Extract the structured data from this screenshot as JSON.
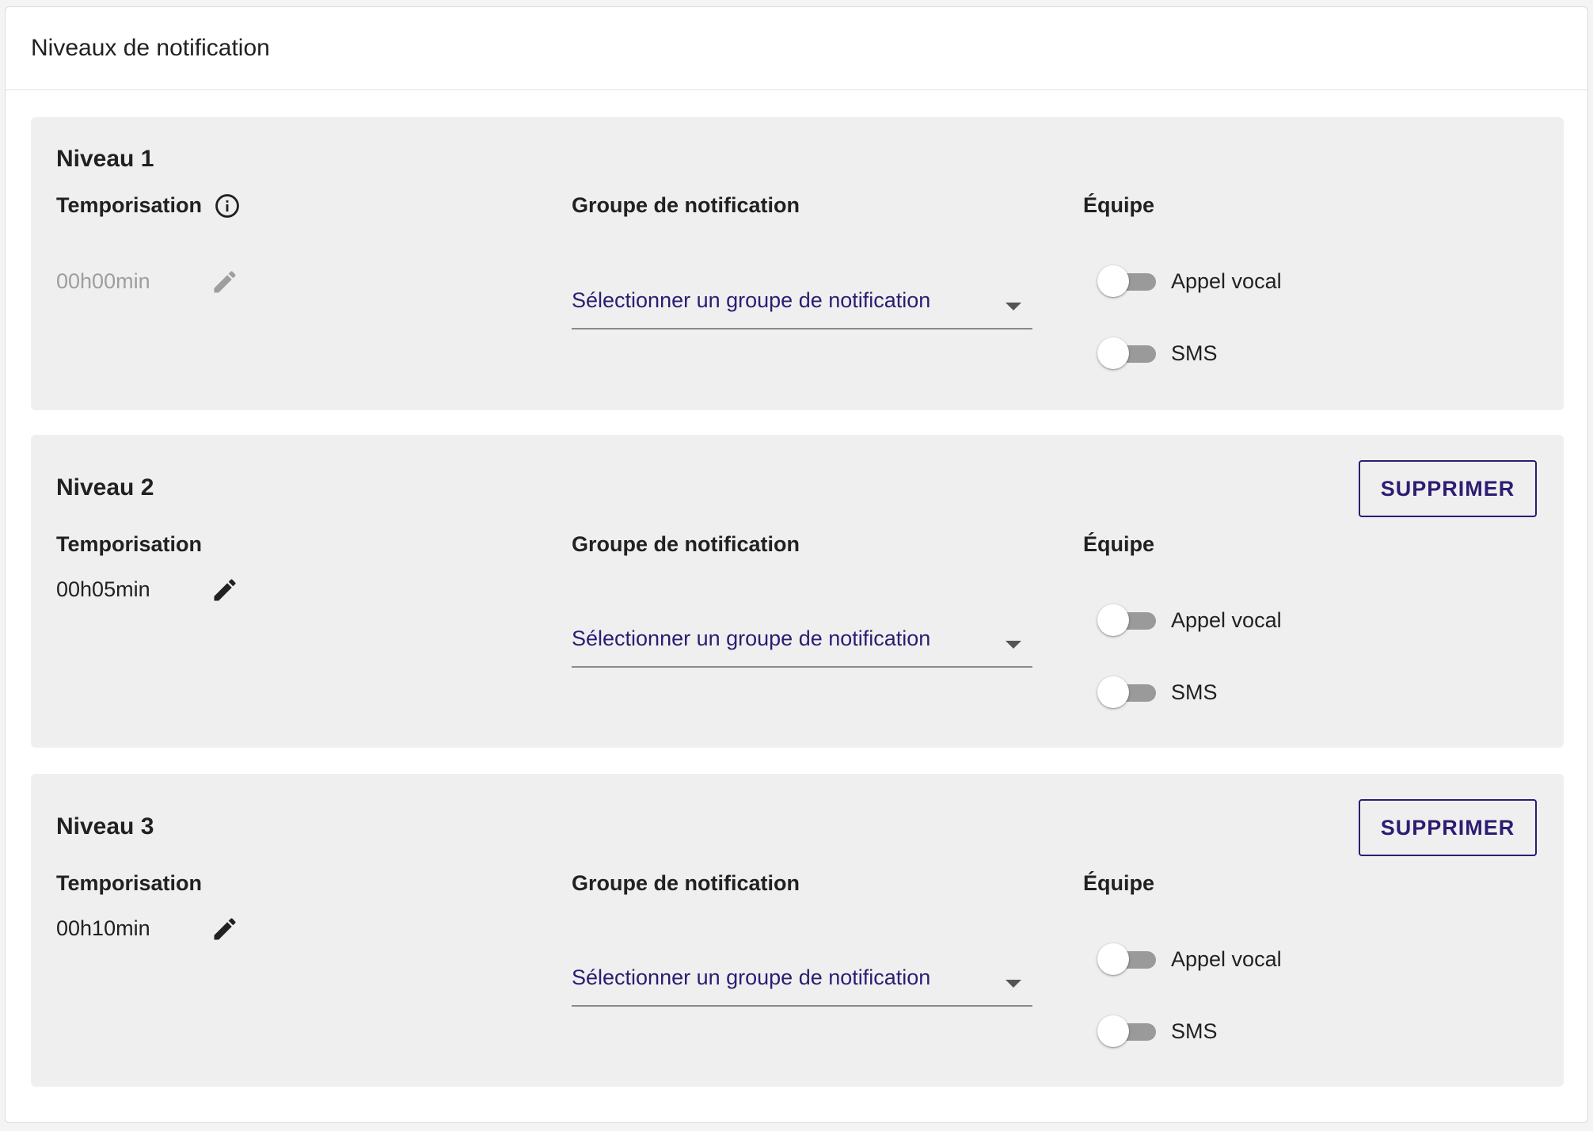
{
  "header": {
    "title": "Niveaux de notification"
  },
  "levels": [
    {
      "title": "Niveau 1",
      "delay_label": "Temporisation",
      "delay_value": "00h00min",
      "delay_disabled": true,
      "group_label": "Groupe de notification",
      "group_placeholder": "Sélectionner un groupe de notification",
      "team_label": "Équipe",
      "toggles": [
        {
          "label": "Appel vocal",
          "on": false
        },
        {
          "label": "SMS",
          "on": false
        }
      ]
    },
    {
      "title": "Niveau 2",
      "delete_label": "SUPPRIMER",
      "delay_label": "Temporisation",
      "delay_value": "00h05min",
      "group_label": "Groupe de notification",
      "group_placeholder": "Sélectionner un groupe de notification",
      "team_label": "Équipe",
      "toggles": [
        {
          "label": "Appel vocal",
          "on": false
        },
        {
          "label": "SMS",
          "on": false
        }
      ]
    },
    {
      "title": "Niveau 3",
      "delete_label": "SUPPRIMER",
      "delay_label": "Temporisation",
      "delay_value": "00h10min",
      "group_label": "Groupe de notification",
      "group_placeholder": "Sélectionner un groupe de notification",
      "team_label": "Équipe",
      "toggles": [
        {
          "label": "Appel vocal",
          "on": false
        },
        {
          "label": "SMS",
          "on": false
        }
      ]
    }
  ],
  "icons": {
    "info": "info-icon",
    "edit": "pencil-icon",
    "dropdown": "caret-down-icon"
  },
  "colors": {
    "accent": "#2d1c72",
    "level_background": "#efefef",
    "toggle_off_track": "#9a9a9a",
    "disabled_text": "#9e9e9e"
  }
}
